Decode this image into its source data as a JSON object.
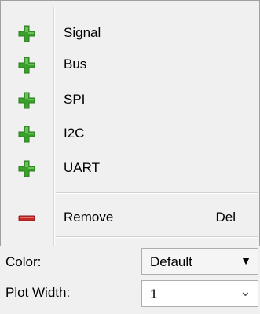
{
  "menu": {
    "items": [
      {
        "label": "Signal",
        "icon": "add-icon"
      },
      {
        "label": "Bus",
        "icon": "add-icon"
      },
      {
        "label": "SPI",
        "icon": "add-icon"
      },
      {
        "label": "I2C",
        "icon": "add-icon"
      },
      {
        "label": "UART",
        "icon": "add-icon"
      }
    ],
    "remove": {
      "label": "Remove",
      "shortcut": "Del",
      "icon": "remove-icon"
    }
  },
  "properties": {
    "color": {
      "label": "Color:",
      "value": "Default",
      "arrow": "▼"
    },
    "plot_width": {
      "label": "Plot Width:",
      "value": "1",
      "arrow": "⌄"
    }
  },
  "colors": {
    "add_green": "#3aa12b",
    "remove_red": "#c62828"
  }
}
